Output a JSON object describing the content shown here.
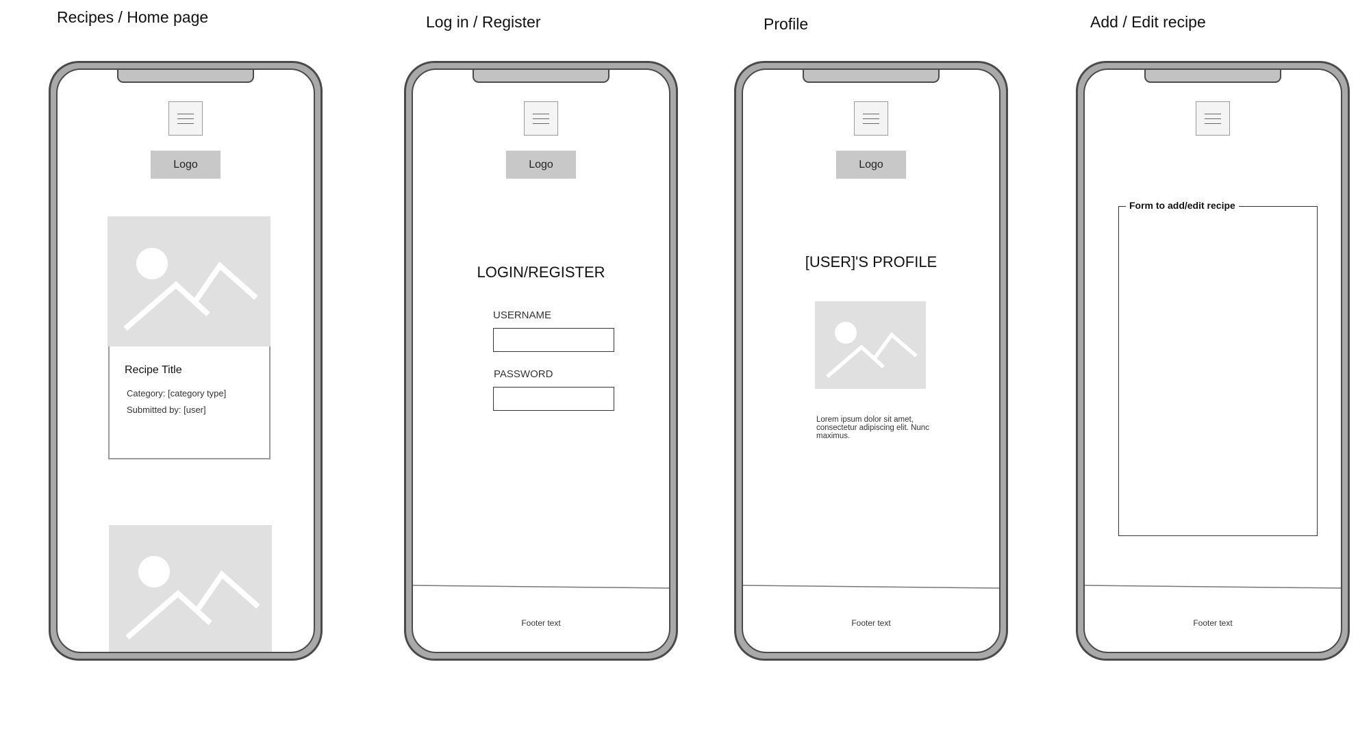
{
  "screens": [
    {
      "title": "Recipes / Home page",
      "logo": "Logo",
      "card": {
        "title": "Recipe Title",
        "category": "Category: [category type]",
        "submitted_by": "Submitted by: [user]"
      }
    },
    {
      "title": "Log in / Register",
      "logo": "Logo",
      "heading": "LOGIN/REGISTER",
      "username_label": "USERNAME",
      "password_label": "PASSWORD",
      "footer": "Footer text"
    },
    {
      "title": "Profile",
      "logo": "Logo",
      "heading": "[USER]'S PROFILE",
      "bio": "Lorem ipsum dolor sit amet, consectetur adipiscing elit. Nunc maximus.",
      "footer": "Footer text"
    },
    {
      "title": "Add / Edit recipe",
      "form_legend": "Form to add/edit recipe",
      "footer": "Footer text"
    }
  ],
  "icons": {
    "menu": "hamburger-menu-icon",
    "image_placeholder": "image-placeholder-icon"
  },
  "colors": {
    "placeholder_bg": "#e0e0e0",
    "logo_bg": "#c8c8c8",
    "phone_frame": "#a9a9a9"
  }
}
